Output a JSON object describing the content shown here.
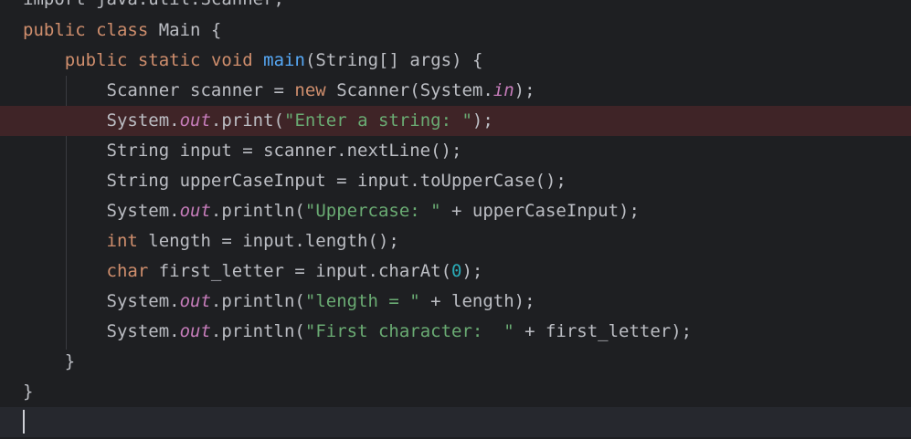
{
  "editor": {
    "lines": [
      [
        {
          "t": "import java.util.Scanner;",
          "c": "kw-import"
        }
      ],
      [
        {
          "t": "public",
          "c": "kw"
        },
        {
          "t": " ",
          "c": "pl"
        },
        {
          "t": "class",
          "c": "kw"
        },
        {
          "t": " Main {",
          "c": "pl"
        }
      ],
      [
        {
          "t": "    ",
          "c": "pl"
        },
        {
          "t": "public",
          "c": "kw"
        },
        {
          "t": " ",
          "c": "pl"
        },
        {
          "t": "static",
          "c": "kw"
        },
        {
          "t": " ",
          "c": "pl"
        },
        {
          "t": "void",
          "c": "kw"
        },
        {
          "t": " ",
          "c": "pl"
        },
        {
          "t": "main",
          "c": "fn"
        },
        {
          "t": "(String[] args) {",
          "c": "pl"
        }
      ],
      [
        {
          "t": "        Scanner scanner = ",
          "c": "pl"
        },
        {
          "t": "new",
          "c": "kw"
        },
        {
          "t": " Scanner(System.",
          "c": "pl"
        },
        {
          "t": "in",
          "c": "st"
        },
        {
          "t": ");",
          "c": "pl"
        }
      ],
      [
        {
          "t": "        System.",
          "c": "pl"
        },
        {
          "t": "out",
          "c": "st"
        },
        {
          "t": ".print(",
          "c": "pl"
        },
        {
          "t": "\"Enter a string: \"",
          "c": "str"
        },
        {
          "t": ");",
          "c": "pl"
        }
      ],
      [
        {
          "t": "        String input = scanner.nextLine();",
          "c": "pl"
        }
      ],
      [
        {
          "t": "        String upperCaseInput = input.toUpperCase();",
          "c": "pl"
        }
      ],
      [
        {
          "t": "        System.",
          "c": "pl"
        },
        {
          "t": "out",
          "c": "st"
        },
        {
          "t": ".println(",
          "c": "pl"
        },
        {
          "t": "\"Uppercase: \"",
          "c": "str"
        },
        {
          "t": " + upperCaseInput);",
          "c": "pl"
        }
      ],
      [
        {
          "t": "        ",
          "c": "pl"
        },
        {
          "t": "int",
          "c": "kw"
        },
        {
          "t": " length = input.length();",
          "c": "pl"
        }
      ],
      [
        {
          "t": "        ",
          "c": "pl"
        },
        {
          "t": "char",
          "c": "kw"
        },
        {
          "t": " first_letter = input.charAt(",
          "c": "pl"
        },
        {
          "t": "0",
          "c": "num"
        },
        {
          "t": ");",
          "c": "pl"
        }
      ],
      [
        {
          "t": "        System.",
          "c": "pl"
        },
        {
          "t": "out",
          "c": "st"
        },
        {
          "t": ".println(",
          "c": "pl"
        },
        {
          "t": "\"length = \"",
          "c": "str"
        },
        {
          "t": " + length);",
          "c": "pl"
        }
      ],
      [
        {
          "t": "        System.",
          "c": "pl"
        },
        {
          "t": "out",
          "c": "st"
        },
        {
          "t": ".println(",
          "c": "pl"
        },
        {
          "t": "\"First character:  \"",
          "c": "str"
        },
        {
          "t": " + first_letter);",
          "c": "pl"
        }
      ],
      [
        {
          "t": "    }",
          "c": "pl"
        }
      ],
      [
        {
          "t": "}",
          "c": "pl"
        }
      ],
      [
        {
          "t": "",
          "c": "pl"
        }
      ]
    ]
  },
  "colors": {
    "background": "#1e1f22",
    "keyword": "#cf8e6d",
    "method": "#56a8f5",
    "static_field": "#c77dbb",
    "string": "#6aab73",
    "number": "#2aacb8",
    "plain": "#bcbec4",
    "breakpoint_line": "#3f2427"
  }
}
